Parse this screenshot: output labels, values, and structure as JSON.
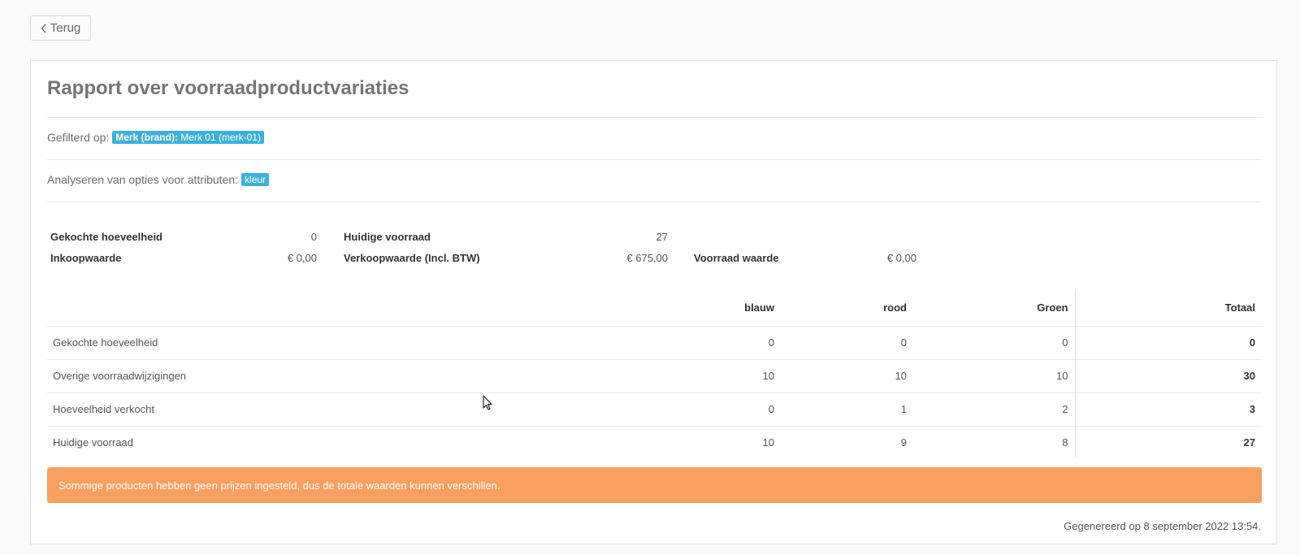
{
  "nav": {
    "back_label": "Terug"
  },
  "report": {
    "title": "Rapport over voorraadproductvariaties",
    "filter_label": "Gefilterd op:",
    "filter_badge_key": "Merk (brand):",
    "filter_badge_value": "Merk 01 (merk-01)",
    "attributes_label": "Analyseren van opties voor attributen:",
    "attributes_badge": "kleur"
  },
  "summary": {
    "purchased_qty_label": "Gekochte hoeveelheid",
    "purchased_qty_value": "0",
    "current_stock_label": "Huidige voorraad",
    "current_stock_value": "27",
    "purchase_value_label": "Inkoopwaarde",
    "purchase_value_value": "€ 0,00",
    "sales_value_label": "Verkoopwaarde (Incl. BTW)",
    "sales_value_value": "€ 675,00",
    "stock_value_label": "Voorraad waarde",
    "stock_value_value": "€ 0,00"
  },
  "table": {
    "columns": [
      "blauw",
      "rood",
      "Groen"
    ],
    "total_label": "Totaal",
    "rows": [
      {
        "label": "Gekochte hoeveelheid",
        "values": [
          "0",
          "0",
          "0"
        ],
        "total": "0"
      },
      {
        "label": "Overige voorraadwijzigingen",
        "values": [
          "10",
          "10",
          "10"
        ],
        "total": "30"
      },
      {
        "label": "Hoeveelheid verkocht",
        "values": [
          "0",
          "1",
          "2"
        ],
        "total": "3"
      },
      {
        "label": "Huidige voorraad",
        "values": [
          "10",
          "9",
          "8"
        ],
        "total": "27"
      }
    ]
  },
  "alert": {
    "text": "Sommige producten hebben geen prijzen ingesteld, dus de totale waarden kunnen verschillen."
  },
  "footer": {
    "generated": "Gegenereerd op 8 september 2022 13:54."
  },
  "colors": {
    "badge": "#3ab0dc",
    "alert": "#f99f5f"
  }
}
